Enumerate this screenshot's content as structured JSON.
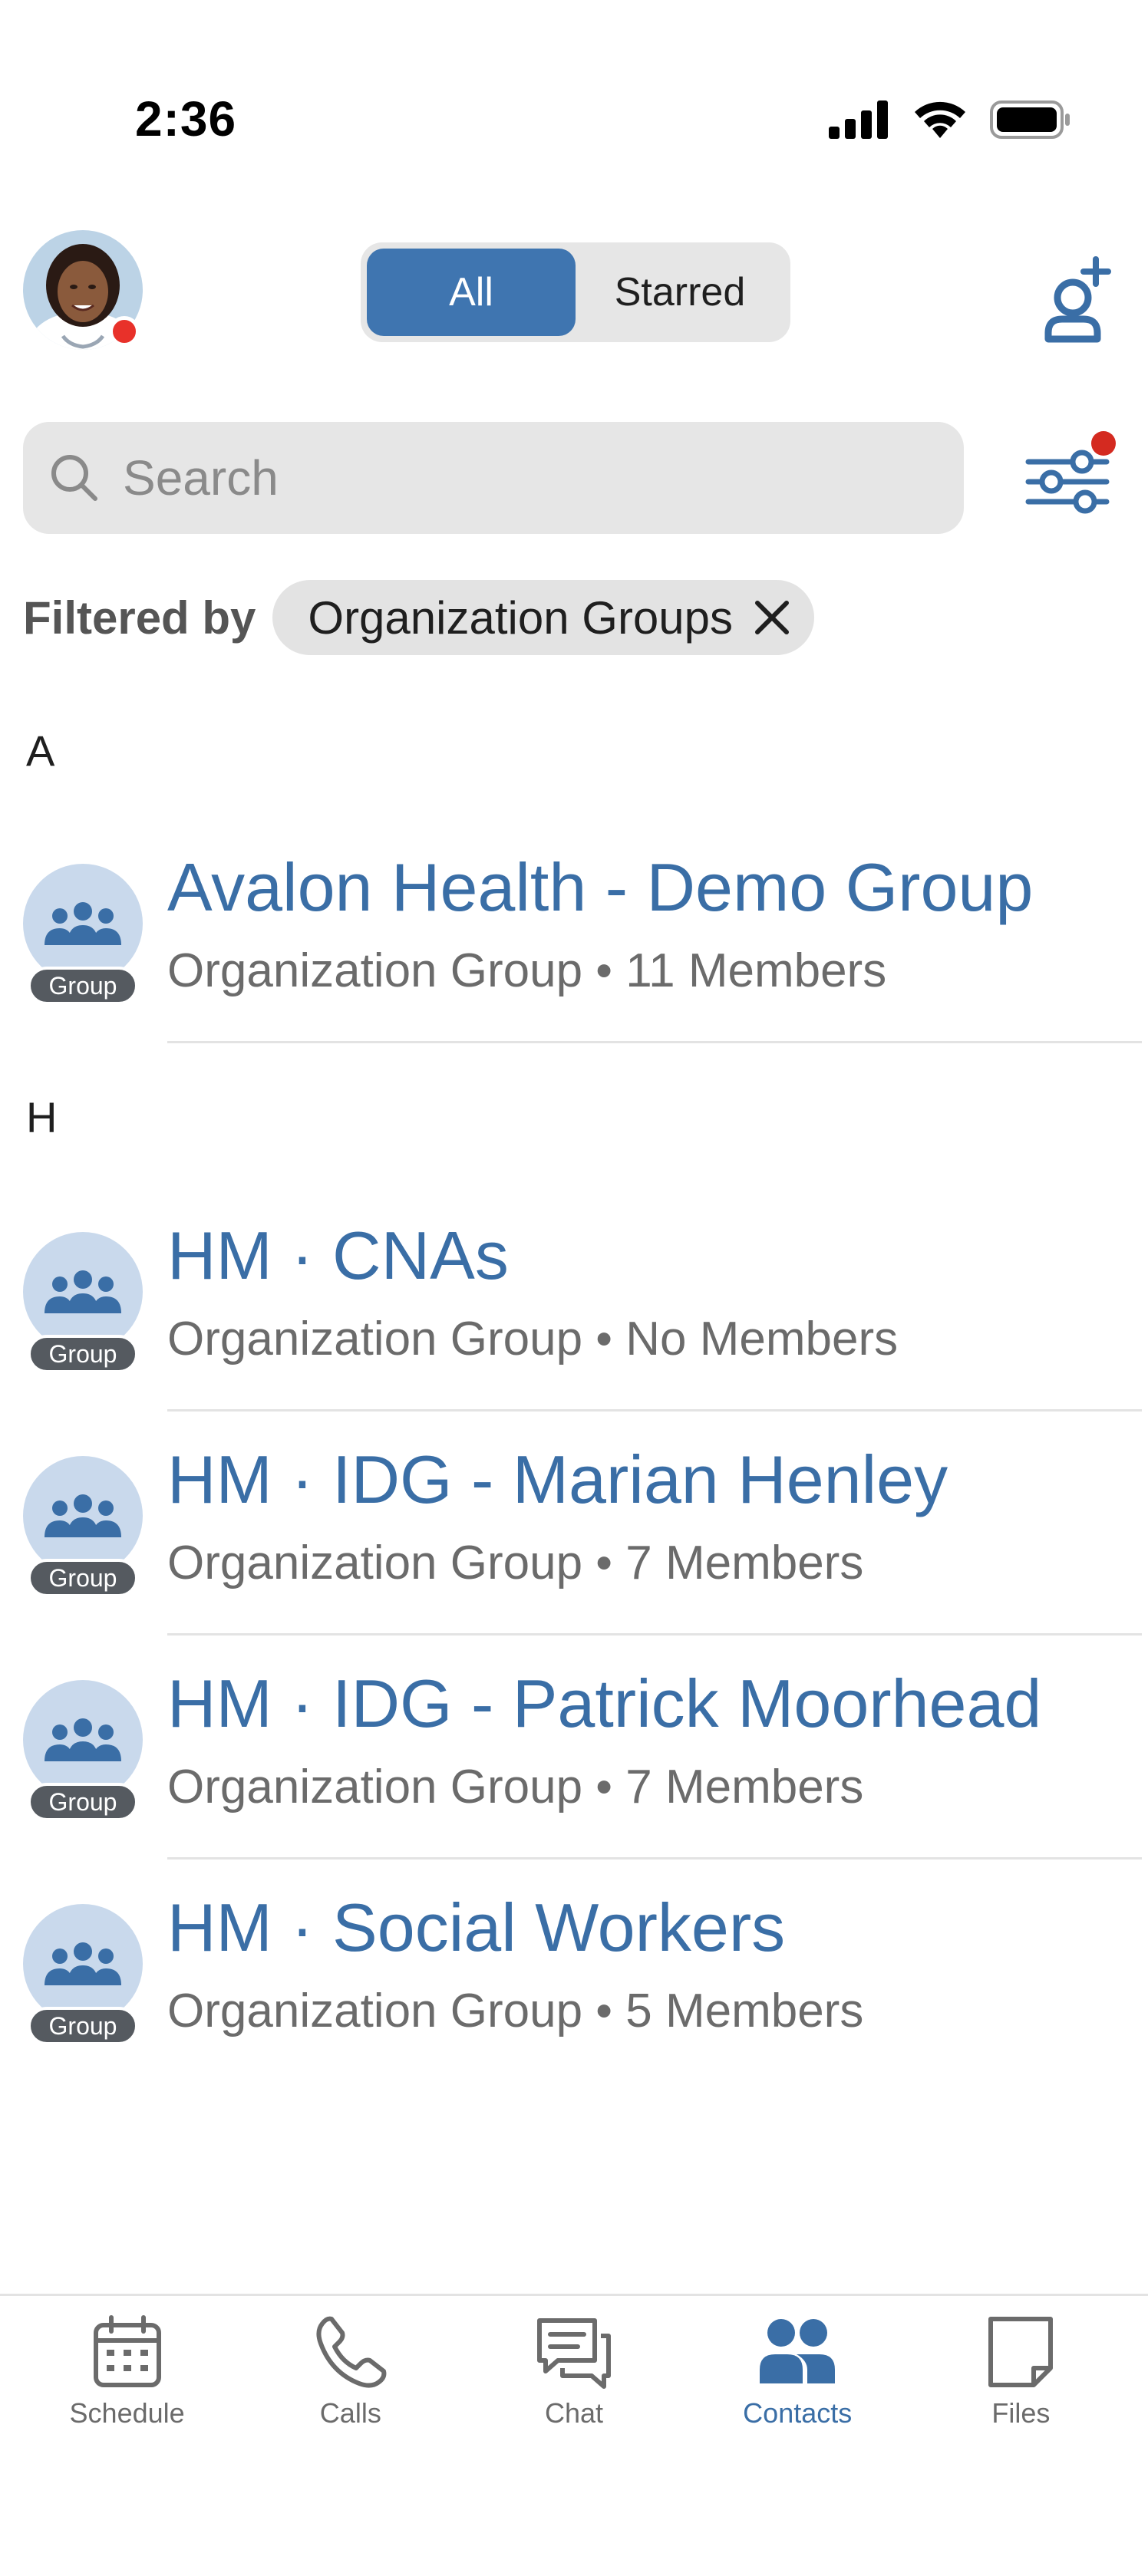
{
  "status_bar": {
    "time": "2:36"
  },
  "header": {
    "segments": [
      {
        "label": "All",
        "active": true
      },
      {
        "label": "Starred",
        "active": false
      }
    ]
  },
  "search": {
    "placeholder": "Search"
  },
  "filter": {
    "label": "Filtered by",
    "chip": "Organization Groups",
    "has_active_filters": true
  },
  "badge_label": "Group",
  "sections": [
    {
      "letter": "A",
      "rows": [
        {
          "name": "Avalon Health - Demo Group",
          "subtitle": "Organization Group • 11 Members"
        }
      ]
    },
    {
      "letter": "H",
      "rows": [
        {
          "name": "HM · CNAs",
          "subtitle": "Organization Group • No Members"
        },
        {
          "name": "HM · IDG - Marian Henley",
          "subtitle": "Organization Group • 7 Members"
        },
        {
          "name": "HM · IDG - Patrick Moorhead",
          "subtitle": "Organization Group • 7 Members"
        },
        {
          "name": "HM · Social Workers",
          "subtitle": "Organization Group • 5 Members"
        }
      ]
    }
  ],
  "tabs": [
    {
      "label": "Schedule",
      "icon": "calendar-icon",
      "active": false
    },
    {
      "label": "Calls",
      "icon": "phone-icon",
      "active": false
    },
    {
      "label": "Chat",
      "icon": "chat-icon",
      "active": false
    },
    {
      "label": "Contacts",
      "icon": "contacts-icon",
      "active": true
    },
    {
      "label": "Files",
      "icon": "file-icon",
      "active": false
    }
  ],
  "colors": {
    "accent": "#3f75b0",
    "link": "#3a6ea6",
    "presence": "#e8312a",
    "group_avatar_bg": "#c9d9ec"
  }
}
